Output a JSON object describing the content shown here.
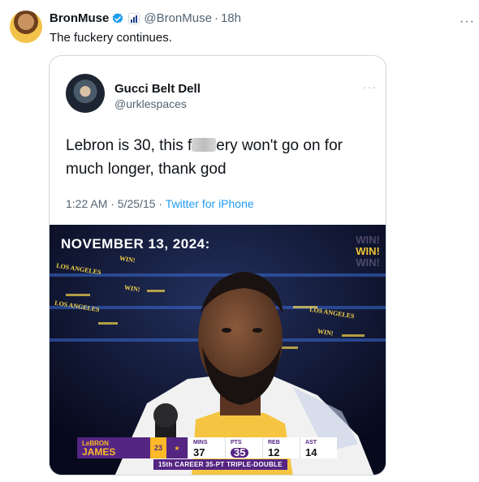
{
  "post": {
    "author_name": "BronMuse",
    "author_handle": "@BronMuse",
    "separator": "·",
    "time": "18h",
    "more": "···",
    "text": "The fuckery continues."
  },
  "quoted": {
    "author_name": "Gucci Belt Dell",
    "author_handle": "@urklespaces",
    "more": "···",
    "text_before": "Lebron is 30, this f",
    "text_after": "ery won't go on for much longer, thank god",
    "timestamp": "1:22 AM · 5/25/15 ·",
    "via": "Twitter for iPhone"
  },
  "media": {
    "date_banner": "NOVEMBER 13, 2024:",
    "win_ghost_top": "WIN!",
    "win_lit": "WIN!",
    "win_ghost_bottom": "WIN!",
    "crowd_labels": [
      "LOS ANGELES",
      "LOS ANGELES",
      "WIN!",
      "WIN!",
      "WIN!",
      "LOS ANGELES"
    ],
    "scorebar": {
      "first_name": "LeBRON",
      "last_name": "JAMES",
      "number": "23",
      "stats": [
        {
          "label": "MINS",
          "value": "37"
        },
        {
          "label": "PTS",
          "value": "35"
        },
        {
          "label": "REB",
          "value": "12"
        },
        {
          "label": "AST",
          "value": "14"
        }
      ],
      "footer": "15th CAREER 35-PT TRIPLE-DOUBLE"
    }
  },
  "colors": {
    "verified_blue": "#1d9bf0",
    "lakers_purple": "#552583",
    "lakers_gold": "#fdb927"
  },
  "icons": {
    "verified": "verified-badge-icon",
    "affiliate": "affiliate-badge-icon",
    "more": "more-icon"
  }
}
